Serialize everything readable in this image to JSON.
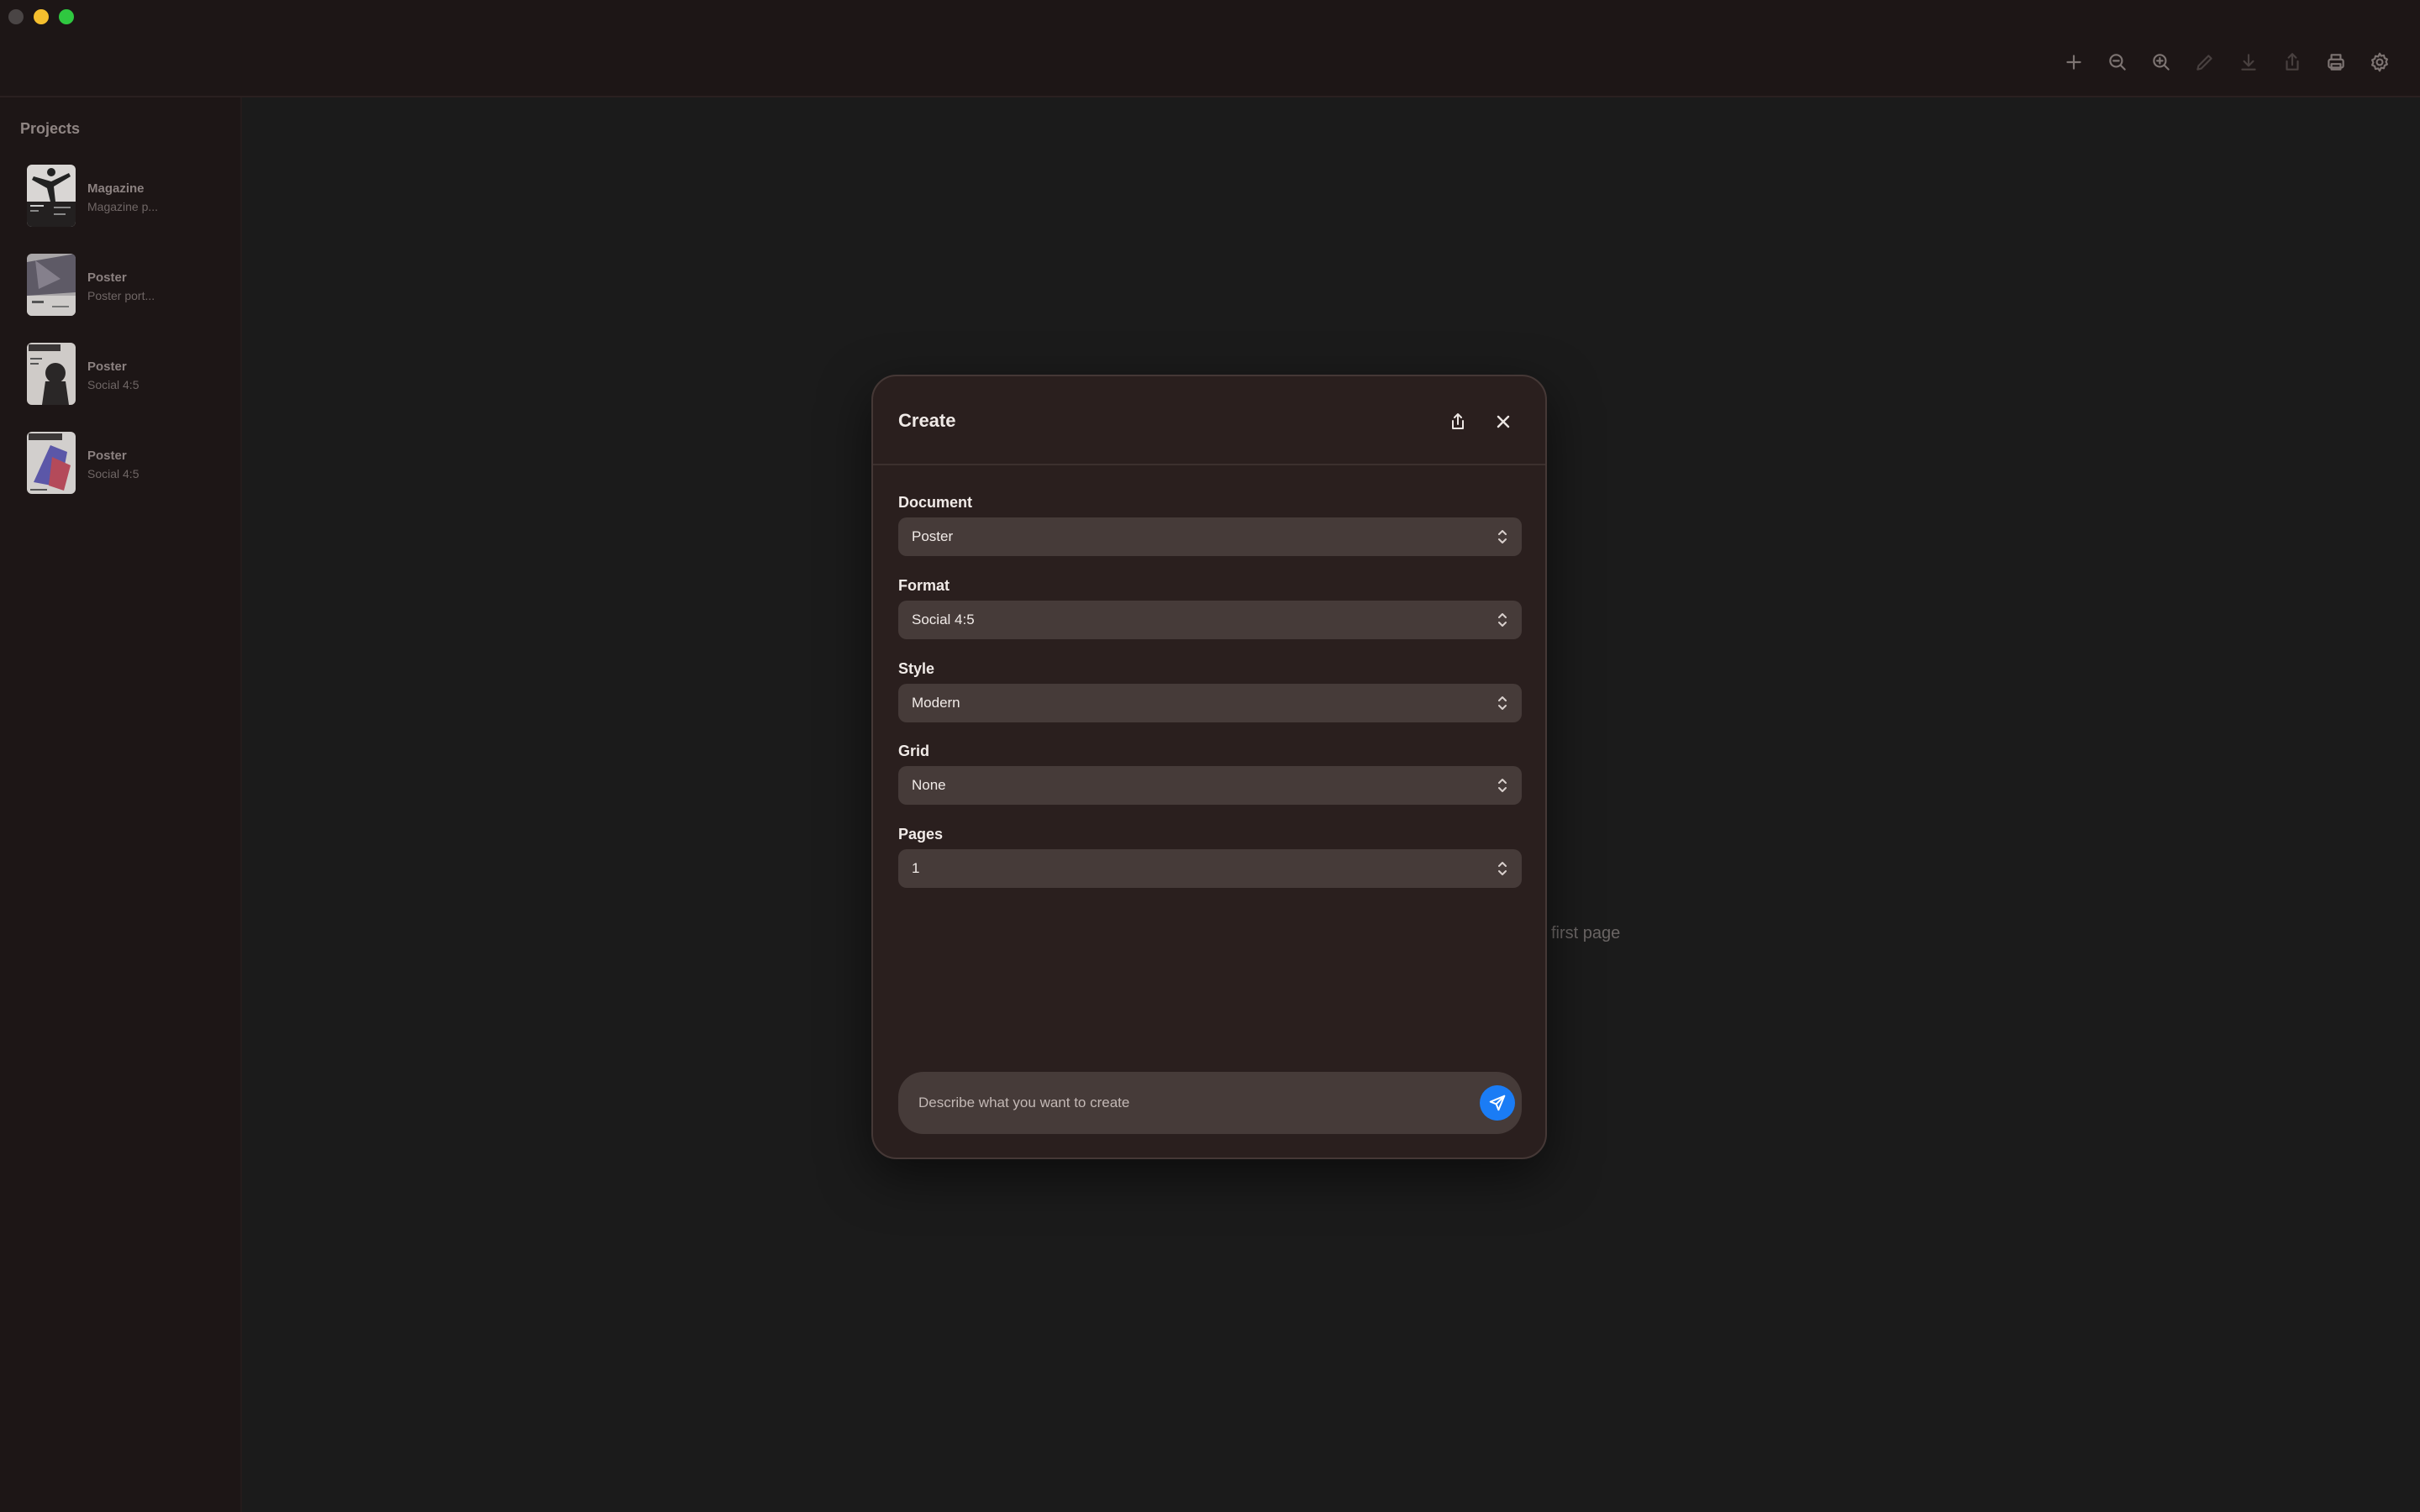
{
  "sidebar": {
    "title": "Projects",
    "projects": [
      {
        "name": "Magazine",
        "subtitle": "Magazine p..."
      },
      {
        "name": "Poster",
        "subtitle": "Poster port..."
      },
      {
        "name": "Poster",
        "subtitle": "Social 4:5"
      },
      {
        "name": "Poster",
        "subtitle": "Social 4:5"
      }
    ]
  },
  "main": {
    "hint": "first page"
  },
  "modal": {
    "title": "Create",
    "fields": [
      {
        "label": "Document",
        "value": "Poster"
      },
      {
        "label": "Format",
        "value": "Social 4:5"
      },
      {
        "label": "Style",
        "value": "Modern"
      },
      {
        "label": "Grid",
        "value": "None"
      },
      {
        "label": "Pages",
        "value": "1"
      }
    ],
    "prompt": {
      "placeholder": "Describe what you want to create"
    }
  },
  "colors": {
    "accent": "#1a7cf5",
    "window_bg": "#1b1b1b",
    "sidebar_bg": "#1d1616",
    "modal_bg": "#2a1f1e",
    "field_bg": "#463b39"
  },
  "icons": {
    "toolbar": [
      "plus-icon",
      "zoom-out-icon",
      "zoom-in-icon",
      "pencil-icon",
      "download-icon",
      "share-icon",
      "print-icon",
      "gear-icon"
    ],
    "modal_header": [
      "share-icon",
      "close-icon"
    ],
    "send": "send-icon"
  }
}
